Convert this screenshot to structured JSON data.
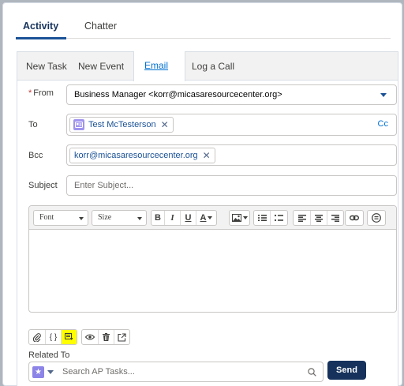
{
  "top_tabs": [
    {
      "label": "Activity",
      "active": true
    },
    {
      "label": "Chatter",
      "active": false
    }
  ],
  "sub_tabs": [
    {
      "label": "New Task"
    },
    {
      "label": "New Event"
    },
    {
      "label": "Email",
      "active": true
    },
    {
      "label": "Log a Call"
    }
  ],
  "form": {
    "from": {
      "required_mark": "*",
      "label": "From",
      "value": "Business Manager <korr@micasaresourcecenter.org>"
    },
    "to": {
      "label": "To",
      "recipient": "Test McTesterson",
      "cc_label": "Cc"
    },
    "bcc": {
      "label": "Bcc",
      "recipient": "korr@micasaresourcecenter.org"
    },
    "subject": {
      "label": "Subject",
      "placeholder": "Enter Subject..."
    }
  },
  "editor": {
    "font_label": "Font",
    "size_label": "Size",
    "bold": "B",
    "italic": "I",
    "underline": "U",
    "text_color": "A"
  },
  "bottom_toolbar": {
    "merge_fields": "{ }"
  },
  "related": {
    "label": "Related To",
    "placeholder": "Search AP Tasks..."
  },
  "send_label": "Send",
  "colors": {
    "brand": "#16325c",
    "link": "#0070d2",
    "highlight": "#ffff00",
    "contact_icon": "#a094ed"
  }
}
